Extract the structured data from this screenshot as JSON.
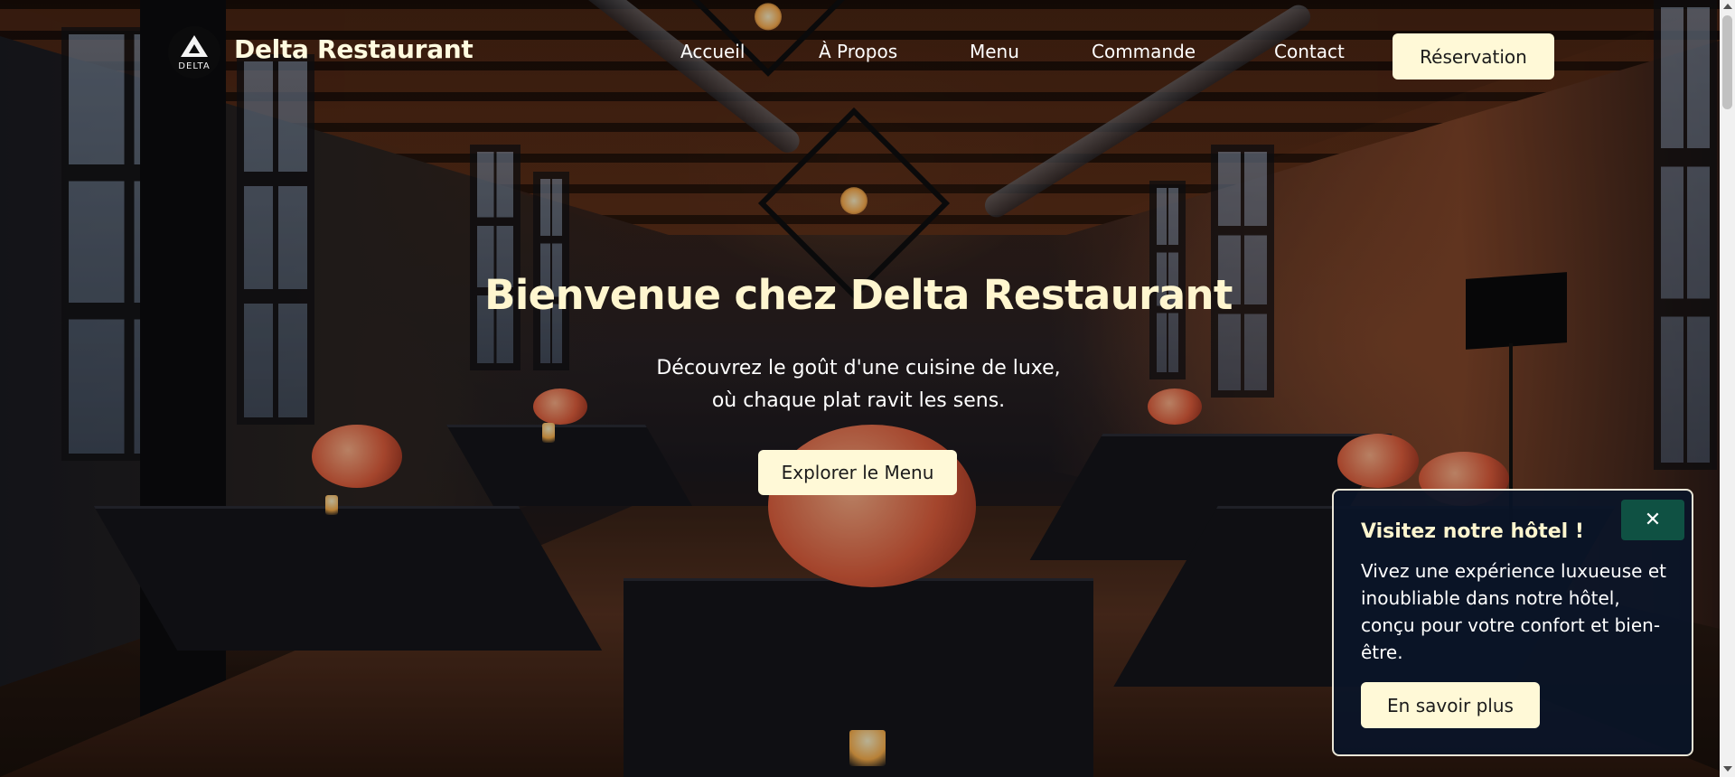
{
  "header": {
    "logo_text": "DELTA",
    "brand": "Delta Restaurant",
    "nav": [
      {
        "label": "Accueil"
      },
      {
        "label": "À Propos"
      },
      {
        "label": "Menu"
      },
      {
        "label": "Commande"
      },
      {
        "label": "Contact"
      }
    ],
    "reserve_label": "Réservation"
  },
  "hero": {
    "title": "Bienvenue chez Delta Restaurant",
    "subtitle_line1": "Découvrez le goût d'une cuisine de luxe,",
    "subtitle_line2": "où chaque plat ravit les sens.",
    "cta_label": "Explorer le Menu",
    "background_image": "restaurant-dining-hall"
  },
  "popup": {
    "close_label": "✕",
    "title": "Visitez notre hôtel !",
    "text": "Vivez une expérience luxueuse et inoubliable dans notre hôtel, conçu pour votre confort et bien-être.",
    "button_label": "En savoir plus"
  },
  "colors": {
    "cream": "#fff9d7",
    "title_cream": "#fff6cf",
    "popup_bg": "#0a1528",
    "close_green": "#0f5143"
  }
}
